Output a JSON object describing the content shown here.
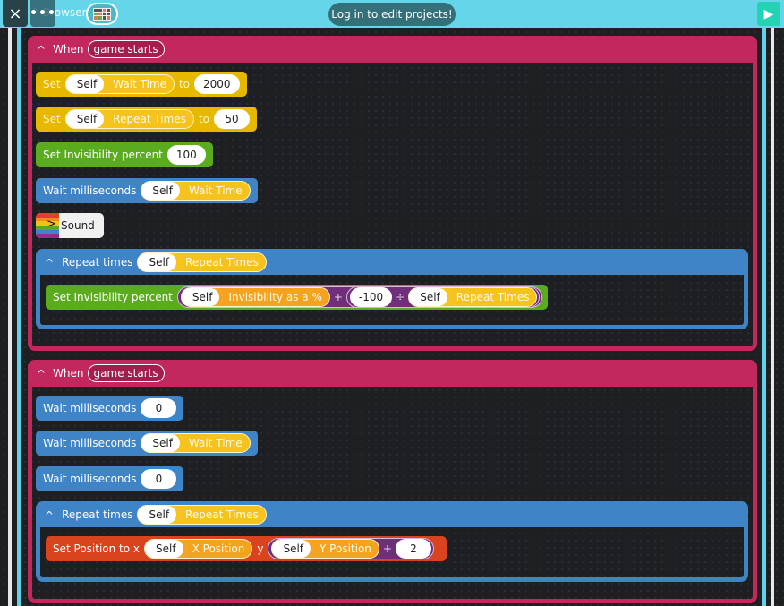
{
  "topbar": {
    "close_icon": "×",
    "more_icon": "•••",
    "browser_label": "^ Browser",
    "login_message": "Log in to edit projects!",
    "play_icon": "▶"
  },
  "scripts": [
    {
      "trigger_prefix": "When",
      "trigger_event": "game starts",
      "blocks": [
        {
          "type": "set",
          "label": "Set",
          "object": "Self",
          "variable": "Wait Time",
          "to_label": "to",
          "value": "2000"
        },
        {
          "type": "set",
          "label": "Set",
          "object": "Self",
          "variable": "Repeat Times",
          "to_label": "to",
          "value": "50"
        },
        {
          "type": "invisibility",
          "label": "Set Invisibility percent",
          "value": "100"
        },
        {
          "type": "wait",
          "label": "Wait milliseconds",
          "object": "Self",
          "variable": "Wait Time"
        },
        {
          "type": "sound",
          "label": "Sound"
        },
        {
          "type": "repeat",
          "label": "Repeat times",
          "object": "Self",
          "variable": "Repeat Times",
          "children": [
            {
              "type": "invisibility-expr",
              "label": "Set Invisibility percent",
              "lhs_object": "Self",
              "lhs_variable": "Invisibility as a %",
              "plus": "+",
              "number": "-100",
              "divide": "÷",
              "rhs_object": "Self",
              "rhs_variable": "Repeat Times"
            }
          ]
        }
      ]
    },
    {
      "trigger_prefix": "When",
      "trigger_event": "game starts",
      "blocks": [
        {
          "type": "wait",
          "label": "Wait milliseconds",
          "value": "0"
        },
        {
          "type": "wait",
          "label": "Wait milliseconds",
          "object": "Self",
          "variable": "Wait Time"
        },
        {
          "type": "wait",
          "label": "Wait milliseconds",
          "value": "0"
        },
        {
          "type": "repeat",
          "label": "Repeat times",
          "object": "Self",
          "variable": "Repeat Times",
          "children": [
            {
              "type": "position",
              "label": "Set Position to x",
              "x_object": "Self",
              "x_variable": "X Position",
              "y_label": "y",
              "y_object": "Self",
              "y_variable": "Y Position",
              "plus": "+",
              "number": "2"
            }
          ]
        }
      ]
    }
  ],
  "colors": {
    "event": "#c2275e",
    "control": "#3e84c6",
    "set": "#e6b800",
    "looks": "#5aab1e",
    "motion": "#d9431e",
    "variable": "#f6c21c",
    "operator": "#6f2f7a",
    "topbar": "#65d6ea",
    "play": "#23d3b3"
  }
}
